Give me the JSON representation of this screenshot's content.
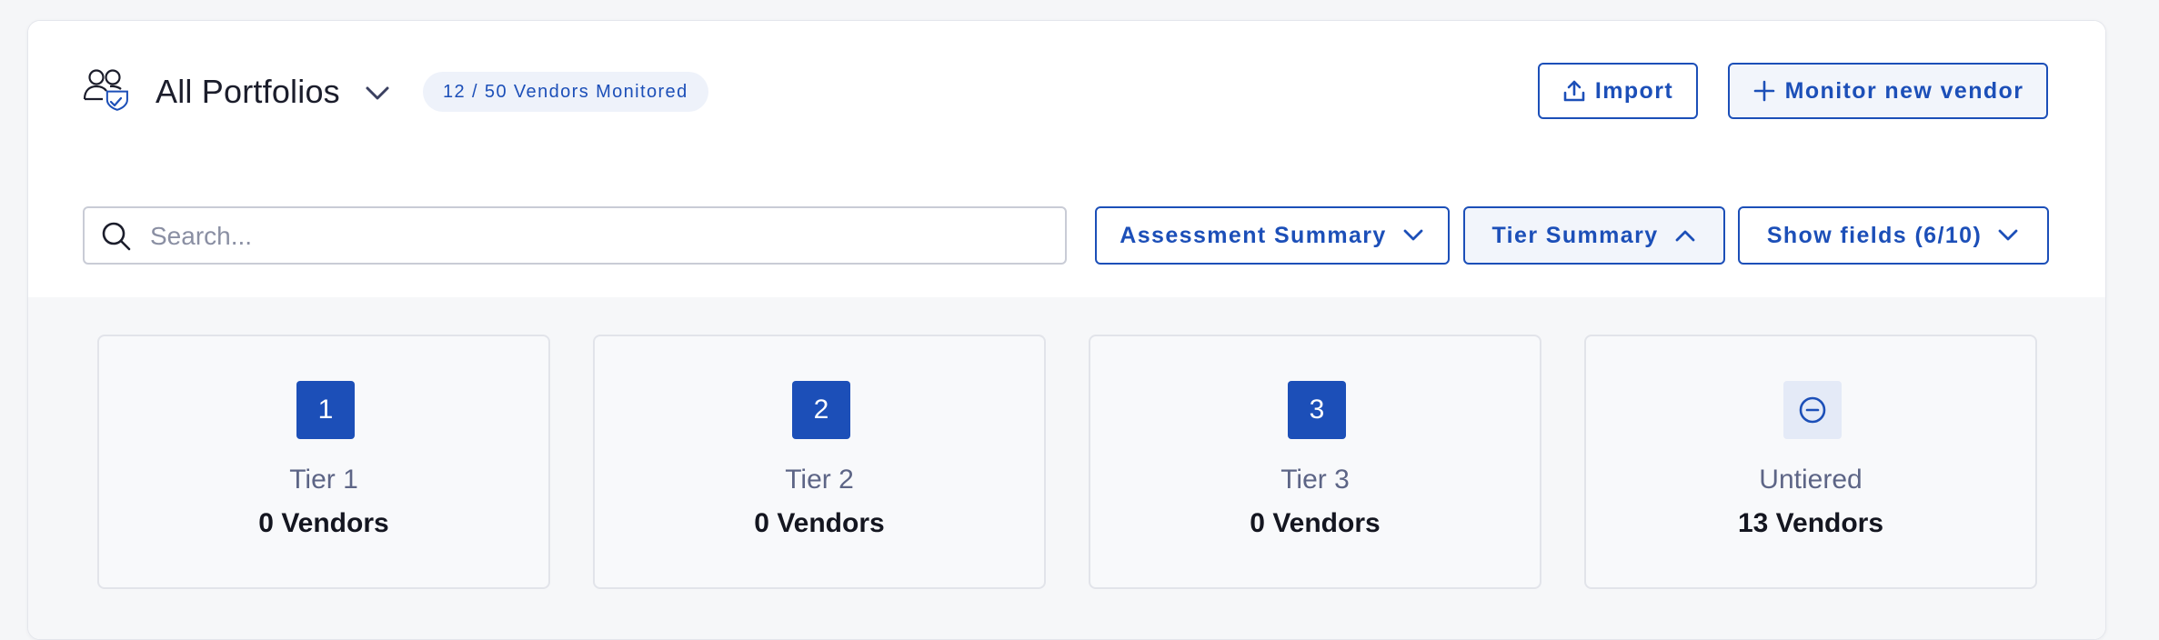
{
  "header": {
    "portfolio_icon": "people-shield-icon",
    "portfolio_title": "All Portfolios",
    "portfolio_chevron": "chevron-down-icon",
    "monitored_badge": "12 / 50 Vendors Monitored",
    "import_button": {
      "label": "Import",
      "icon": "upload-icon"
    },
    "monitor_button": {
      "label": "Monitor new vendor",
      "icon": "plus-icon"
    }
  },
  "toolbar": {
    "search": {
      "placeholder": "Search...",
      "value": "",
      "icon": "search-icon"
    },
    "filters": [
      {
        "label": "Assessment Summary",
        "icon": "chevron-down-icon"
      },
      {
        "label": "Tier Summary",
        "icon": "chevron-up-icon"
      },
      {
        "label": "Show fields (6/10)",
        "icon": "chevron-down-icon"
      }
    ]
  },
  "tiers": [
    {
      "badge": "1",
      "name": "Tier 1",
      "count": "0 Vendors"
    },
    {
      "badge": "2",
      "name": "Tier 2",
      "count": "0 Vendors"
    },
    {
      "badge": "3",
      "name": "Tier 3",
      "count": "0 Vendors"
    },
    {
      "badge": "",
      "badge_icon": "minus-circle-icon",
      "name": "Untiered",
      "count": "13 Vendors"
    }
  ],
  "colors": {
    "accent": "#1c4fb8",
    "badge_bg": "#eef2fa",
    "text_primary": "#1b1d2b",
    "text_secondary": "#5d6586"
  }
}
